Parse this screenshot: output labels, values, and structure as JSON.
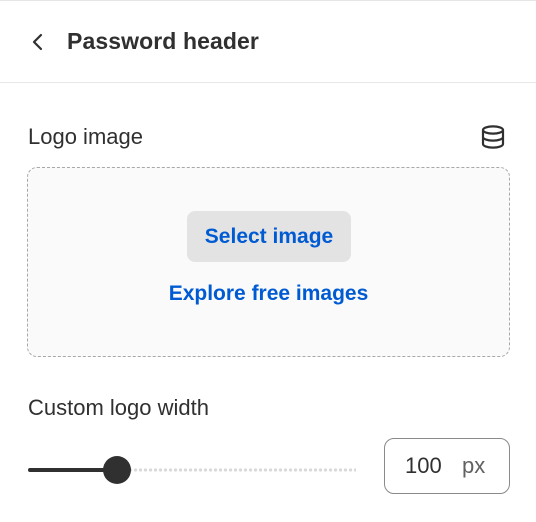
{
  "header": {
    "title": "Password header",
    "back_icon": "chevron-left-icon"
  },
  "logo": {
    "label": "Logo image",
    "source_icon": "database-icon",
    "select_button": "Select image",
    "explore_link": "Explore free images"
  },
  "logo_width": {
    "label": "Custom logo width",
    "value": "100",
    "unit": "px",
    "slider_fraction": 0.27
  },
  "colors": {
    "accent": "#005bd3",
    "text": "#303030",
    "button_bg": "#e3e3e3"
  }
}
